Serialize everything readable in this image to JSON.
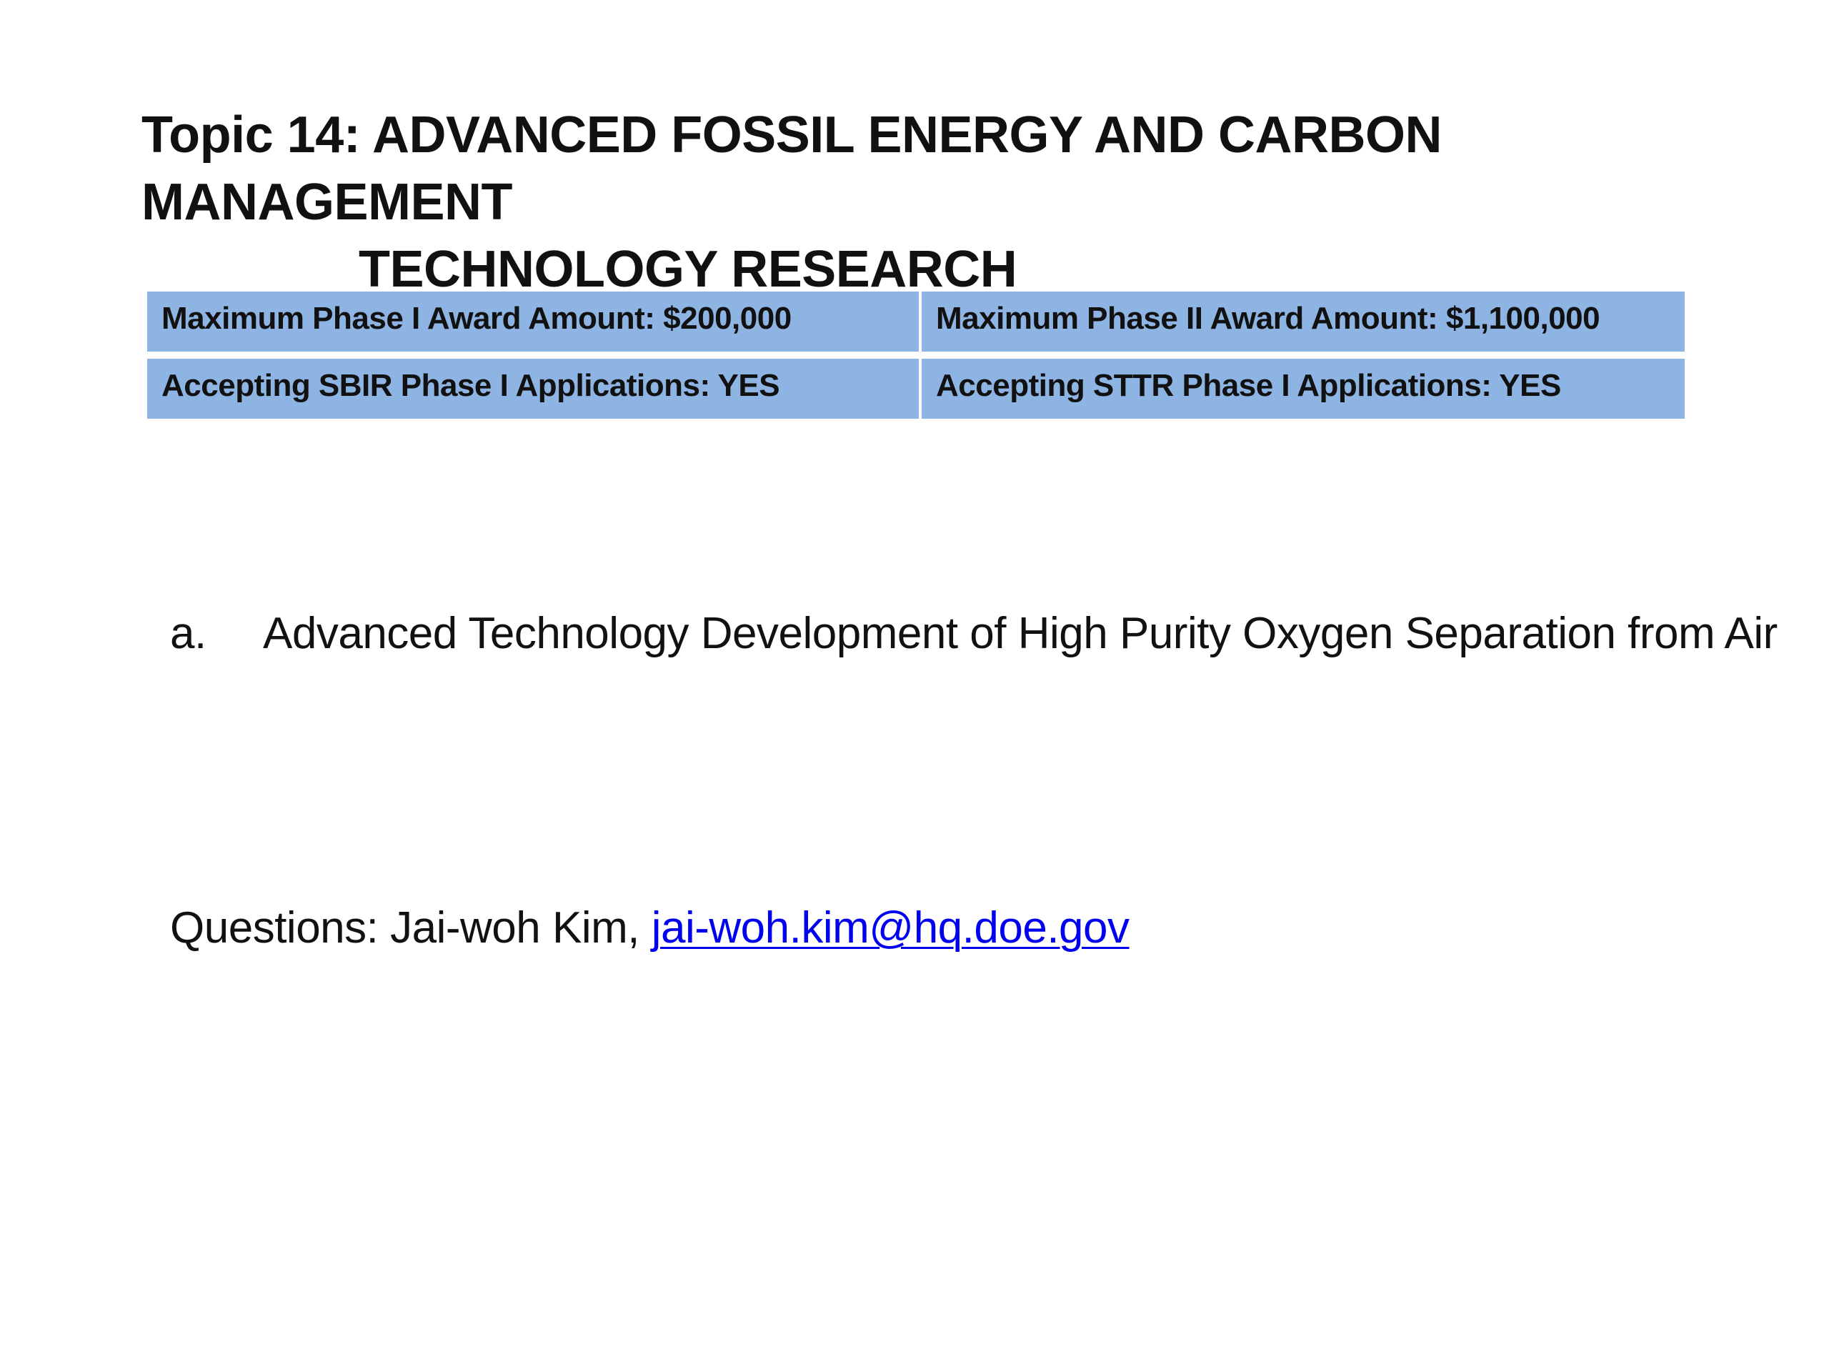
{
  "title": {
    "line1": "Topic 14: ADVANCED FOSSIL ENERGY AND CARBON MANAGEMENT",
    "line2": "TECHNOLOGY RESEARCH"
  },
  "award_table": {
    "rows": [
      {
        "left": "Maximum Phase I Award Amount:  $200,000",
        "right": "Maximum Phase II Award Amount:  $1,100,000"
      },
      {
        "left": "Accepting SBIR Phase I Applications:  YES",
        "right": "Accepting STTR Phase I Applications:  YES"
      }
    ],
    "cell_color": "#8eb4e3"
  },
  "subtopics": [
    {
      "marker": "a.",
      "text": "Advanced Technology Development of High Purity Oxygen Separation from Air"
    }
  ],
  "questions": {
    "prefix": "Questions: Jai-woh Kim, ",
    "email": "jai-woh.kim@hq.doe.gov",
    "link_color": "#0000ee"
  }
}
